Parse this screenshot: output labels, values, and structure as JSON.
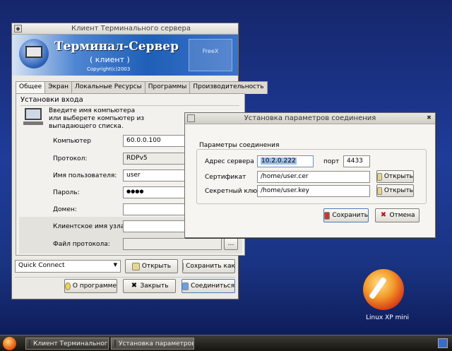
{
  "main_window": {
    "title": "Клиент Терминального сервера",
    "banner": {
      "title": "Терминал-Сервер",
      "subtitle": "( клиент )",
      "copyright": "Copyright(c)2003",
      "emblem": "FreeX"
    },
    "tabs": [
      {
        "label": "Общее",
        "active": true
      },
      {
        "label": "Экран"
      },
      {
        "label": "Локальные Ресурсы"
      },
      {
        "label": "Программы"
      },
      {
        "label": "Производительность"
      }
    ],
    "section_title": "Установки входа",
    "hint": "Введите имя компьютера или выберете компьютер из выпадающего списка.",
    "fields": {
      "computer": {
        "label": "Компьютер",
        "value": "60.0.0.100"
      },
      "protocol": {
        "label": "Протокол:",
        "value": "RDPv5"
      },
      "username": {
        "label": "Имя пользователя:",
        "value": "user"
      },
      "password": {
        "label": "Пароль:",
        "value": "●●●●"
      },
      "domain": {
        "label": "Домен:",
        "value": ""
      },
      "client_host": {
        "label": "Клиентское имя узла::",
        "value": ""
      },
      "log_file": {
        "label": "Файл протокола:",
        "value": ""
      }
    },
    "quick_connect": "Quick Connect",
    "buttons": {
      "open": "Открыть",
      "save_as": "Сохранить как",
      "about": "О программе",
      "close": "Закрыть",
      "connect": "Соединиться"
    }
  },
  "dialog": {
    "title": "Установка параметров соединения",
    "group": "Параметры соединения",
    "server": {
      "label": "Адрес сервера",
      "value": "10.2.0.222"
    },
    "port": {
      "label": "порт",
      "value": "4433"
    },
    "cert": {
      "label": "Сертификат",
      "value": "/home/user.cer"
    },
    "key": {
      "label": "Секретный ключ",
      "value": "/home/user.key"
    },
    "open": "Открыть",
    "save": "Сохранить",
    "cancel": "Отмена"
  },
  "desktop": {
    "logo_label": "Linux XP mini"
  },
  "taskbar": {
    "tasks": [
      "Клиент Терминального...",
      "Установка параметров..."
    ]
  },
  "colors": {
    "desktop": "#1f3c9a",
    "banner": "#1f5fb8",
    "accent_red": "#d01f10"
  }
}
